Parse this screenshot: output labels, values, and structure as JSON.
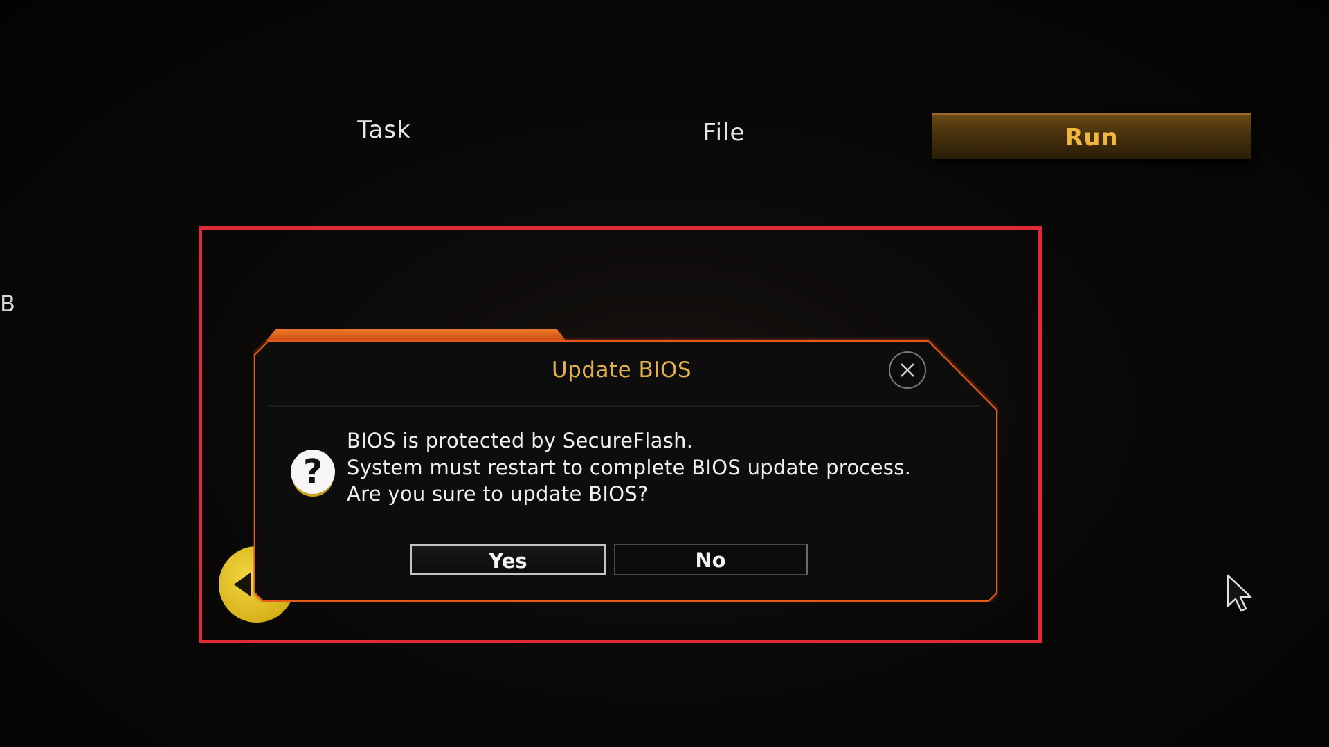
{
  "tabs": {
    "task": "Task",
    "file": "File",
    "run": "Run"
  },
  "side_letter": "B",
  "dialog": {
    "title": "Update BIOS",
    "message_lines": [
      "BIOS is protected by SecureFlash.",
      "System must restart to complete BIOS update process.",
      "Are you sure to update BIOS?"
    ],
    "question_glyph": "?",
    "yes_label": "Yes",
    "no_label": "No"
  },
  "icons": {
    "close": "close-icon",
    "question": "question-icon",
    "back": "chevron-left-icon",
    "cursor": "mouse-pointer-icon"
  },
  "colors": {
    "accent_orange": "#e8661e",
    "title_gold": "#e2b247",
    "annotation_red": "#e02a34",
    "run_tab_text": "#f2b640"
  }
}
